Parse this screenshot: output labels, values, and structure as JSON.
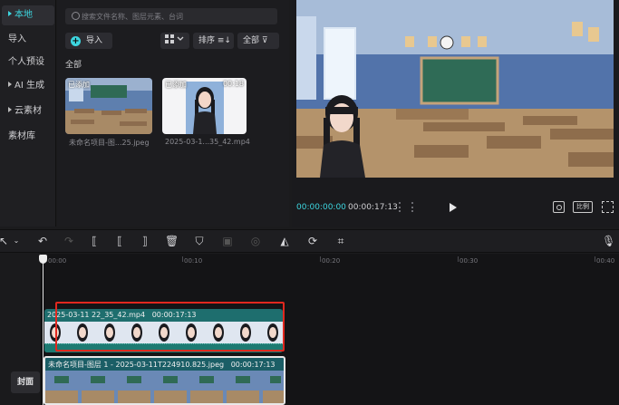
{
  "nav": {
    "items": [
      {
        "label": "本地",
        "expandable": true,
        "active": true
      },
      {
        "label": "导入",
        "expandable": false
      },
      {
        "label": "个人预设",
        "expandable": false
      },
      {
        "label": "AI 生成",
        "expandable": true
      },
      {
        "label": "云素材",
        "expandable": true
      },
      {
        "label": "素材库",
        "expandable": false
      }
    ]
  },
  "media": {
    "search": {
      "placeholder": "搜索文件名称、图层元素、台词"
    },
    "import_label": "导入",
    "sort_label": "排序",
    "filter_label": "全部",
    "section_label": "全部",
    "items": [
      {
        "badge": "已添加",
        "duration": "",
        "filename": "未命名项目-图...25.jpeg"
      },
      {
        "badge": "已添加",
        "duration": "00:18",
        "filename": "2025-03-1...35_42.mp4"
      }
    ]
  },
  "player": {
    "current_time": "00:00:00:00",
    "total_time": "00:00:17:13",
    "ratio_label": "比例"
  },
  "toolbar": {
    "icons": [
      "select-icon",
      "undo-icon",
      "redo-icon",
      "split-icon",
      "split-left-icon",
      "split-right-icon",
      "delete-icon",
      "shield-icon",
      "freeze-icon",
      "record-icon",
      "mirror-icon",
      "rotate-icon",
      "crop-icon",
      "mic-icon"
    ]
  },
  "timeline": {
    "ruler": [
      "00:00",
      "00:10",
      "00:20",
      "00:30",
      "00:40"
    ],
    "clips": [
      {
        "title": "2025-03-11 22_35_42.mp4",
        "duration": "00:00:17:13"
      },
      {
        "title": "未命名项目-图层 1 - 2025-03-11T224910.825.jpeg",
        "duration": "00:00:17:13"
      }
    ],
    "cover_label": "封面"
  },
  "colors": {
    "accent": "#3dd6e0",
    "highlight": "#e0281f",
    "clip_video": "#1e6e6e",
    "clip_image": "#1b5e66"
  }
}
